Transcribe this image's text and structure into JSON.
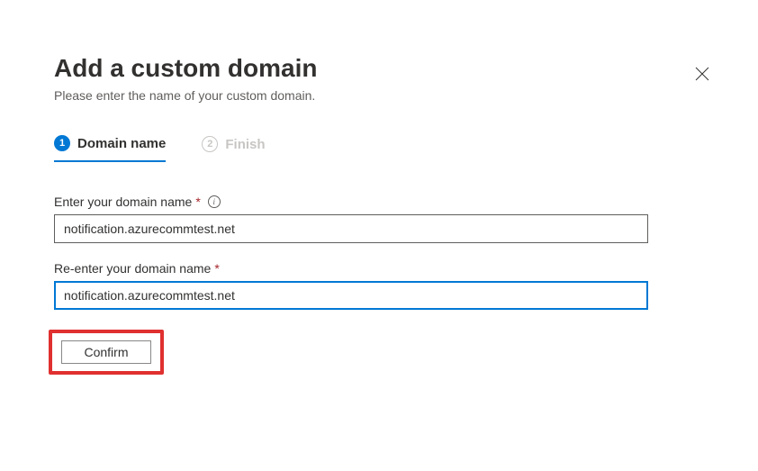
{
  "header": {
    "title": "Add a custom domain",
    "subtitle": "Please enter the name of your custom domain."
  },
  "steps": [
    {
      "num": "1",
      "label": "Domain name",
      "active": true
    },
    {
      "num": "2",
      "label": "Finish",
      "active": false
    }
  ],
  "form": {
    "field1_label": "Enter your domain name",
    "field1_value": "notification.azurecommtest.net",
    "field2_label": "Re-enter your domain name",
    "field2_value": "notification.azurecommtest.net",
    "required_mark": "*",
    "confirm_label": "Confirm"
  },
  "colors": {
    "accent": "#0078d4",
    "highlight_box": "#e03030"
  }
}
